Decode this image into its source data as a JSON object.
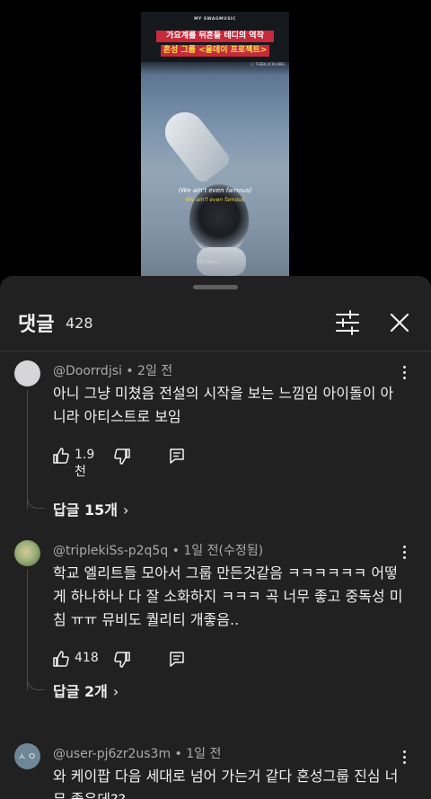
{
  "video": {
    "brand": "MY SWAGMUSIC",
    "title_line1": "가요계를 뒤흔들 테디의 역작",
    "title_line2": "혼성 그룹 <올데이 프로젝트>",
    "credit": "ⓒ THEBLACKLABEL",
    "subtitle_en": "(We ain't even famous)",
    "subtitle_en2": "We ain't even famous",
    "subtitle_small": "우린 유명하지도"
  },
  "sheet": {
    "title": "댓글",
    "count": "428"
  },
  "comments": [
    {
      "meta": "@Doorrdjsi • 2일 전",
      "text": "아니 그냥 미쳤음 전설의 시작을 보는 느낌임 아이돌이 아니라 아티스트로 보임",
      "likes": "1.9천",
      "replies": "답글 15개"
    },
    {
      "meta": "@triplekiSs-p2q5q • 1일 전(수정됨)",
      "text": "학교 엘리트들 모아서 그룹 만든것같음 ㅋㅋㅋㅋㅋㅋ 어떻게 하나하나 다 잘 소화하지 ㅋㅋㅋ 곡 너무 좋고 중독성 미침 ㅠㅠ 뮤비도 퀄리티 개좋음..",
      "likes": "418",
      "replies": "답글 2개"
    },
    {
      "avatar_text": "ㅅㅇ",
      "meta": "@user-pj6zr2us3m • 1일 전",
      "text": "와 케이팝 다음 세대로 넘어 가는거 같다 혼성그룹 진심 너무 좋은데??"
    }
  ],
  "icons": {
    "filter": "sliders-icon",
    "close": "close-icon",
    "like": "thumbs-up-icon",
    "dislike": "thumbs-down-icon",
    "reply": "reply-icon",
    "more": "more-vertical-icon"
  }
}
